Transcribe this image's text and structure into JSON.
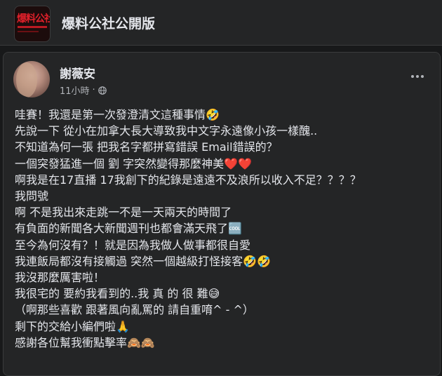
{
  "page": {
    "name": "爆料公社公開版",
    "logo_text": "爆料公社"
  },
  "post": {
    "author": "謝薇安",
    "timestamp": "11小時",
    "separator": "·",
    "lines": [
      "哇賽！我還是第一次發澄清文這種事情🤣",
      "先說一下 從小在加拿大長大導致我中文字永遠像小孩一樣醜..",
      "不知道為何一張 把我名字都拼寫錯誤 Email錯誤的？",
      "一個突發猛進一個 劉 字突然變得那麼神美❤️❤️",
      "啊我是在17直播 17我創下的紀錄是遠遠不及浪所以收入不足？？？？",
      "我問號",
      "啊 不是我出來走跳一不是一天兩天的時間了",
      "有負面的新聞各大新聞週刊也都會滿天飛了🆒",
      "至今為何沒有？！就是因為我做人做事都很自愛",
      "我連飯局都沒有接觸過 突然一個越級打怪接客🤣🤣",
      "我沒那麼厲害啦！",
      "我很宅的 要約我看到的..我 真 的 很 難😅",
      "（啊那些喜歡 跟著風向亂罵的 請自重唷^ - ^）",
      "剩下的交給小編們啦🙏",
      "感謝各位幫我衝點擊率🙈🙈"
    ]
  },
  "colors": {
    "background": "#18191a",
    "card": "#242526",
    "text": "#e4e6eb",
    "secondary": "#b0b3b8",
    "logo_red": "#e0202a"
  },
  "icons": {
    "privacy": "globe-icon",
    "menu": "more-options-icon"
  }
}
